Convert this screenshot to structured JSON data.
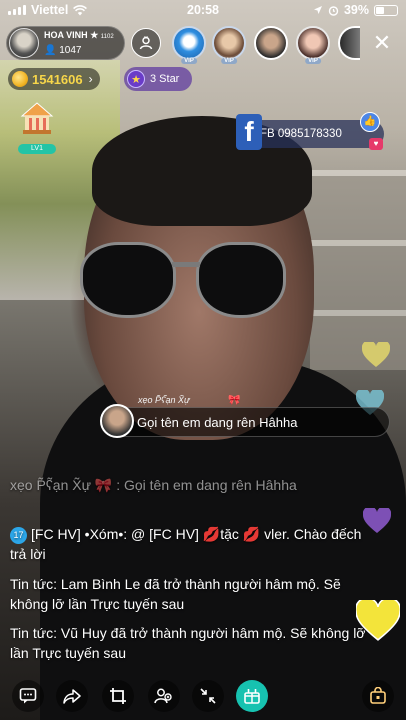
{
  "status_bar": {
    "carrier": "Viettel",
    "time": "20:58",
    "battery": "39%"
  },
  "host": {
    "name": "HOA VINH",
    "level": "1102",
    "viewer_count": "1047"
  },
  "viewers": [
    {
      "badge": "VIP"
    },
    {
      "badge": "VIP"
    },
    {
      "badge": ""
    },
    {
      "badge": "VIP"
    },
    {
      "badge": ""
    }
  ],
  "coins": {
    "value": "1541606"
  },
  "stars": {
    "label": "3 Star"
  },
  "level_badge": {
    "label": "LV1"
  },
  "facebook": {
    "label": "FB 0985178330"
  },
  "highlight_comment": {
    "user": "xẹo P̃ʕ̃ạn X̃ự",
    "text": "Gọi tên em dang rên Hâhha"
  },
  "chat": [
    {
      "user": "xẹo P̃ʕ̃ạn X̃ự",
      "text": "Gọi tên em dang rên Hâhha",
      "faded": true
    },
    {
      "level": "17",
      "user": "[FC HV] •Xóm•: @ [FC HV]",
      "text": "tặc",
      "text2": "vler. Chào đếch trả lời"
    },
    {
      "text": "Tin tức: Lam Bình Le đã trở thành người hâm mộ. Sẽ không lỡ lần Trực tuyến sau"
    },
    {
      "text": "Tin tức: Vũ Huy đã trở thành người hâm mộ. Sẽ không lỡ lần Trực tuyến sau"
    }
  ],
  "colors": {
    "teal": "#17c2b0",
    "coin": "#f6d64a",
    "star_pill": "#603ca0",
    "facebook": "#2d5fb8"
  }
}
